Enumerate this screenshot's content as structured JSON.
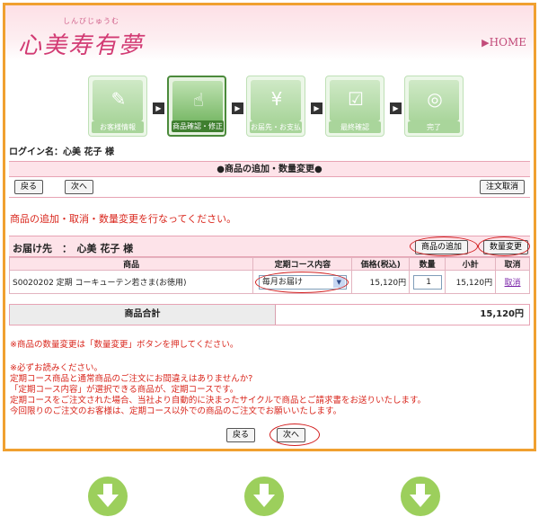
{
  "header": {
    "logo_ruby": "しんびじゅうむ",
    "logo_text": "心美寿有夢",
    "home_link": "HOME",
    "home_arrow": "▶"
  },
  "steps": [
    {
      "label": "お客様情報",
      "icon": "name-card-icon",
      "active": false
    },
    {
      "label": "商品確認・修正",
      "icon": "product-hand-icon",
      "active": true
    },
    {
      "label": "お届先・お支払",
      "icon": "yen-payment-icon",
      "active": false
    },
    {
      "label": "最終確認",
      "icon": "checklist-icon",
      "active": false
    },
    {
      "label": "完了",
      "icon": "globe-icon",
      "active": false
    }
  ],
  "login": "ログイン名：心美 花子 様",
  "section": {
    "title": "●商品の追加・数量変更●",
    "back_label": "戻る",
    "next_label": "次へ",
    "cancel_order_label": "注文取消"
  },
  "instruction": "商品の追加・取消・数量変更を行なってください。",
  "delivery": {
    "label": "お届け先　：　心美 花子 様",
    "add_product_label": "商品の追加",
    "change_qty_label": "数量変更"
  },
  "table": {
    "headers": [
      "商品",
      "定期コース内容",
      "価格(税込)",
      "数量",
      "小計",
      "取消"
    ],
    "rows": [
      {
        "product": "S0020202 定期 コーキューテン若さま(お徳用)",
        "course": "毎月お届け",
        "price": "15,120円",
        "quantity": "1",
        "subtotal": "15,120円",
        "cancel": "取消"
      }
    ]
  },
  "total": {
    "label": "商品合計",
    "value": "15,120円"
  },
  "notes": {
    "qty_hint": "※商品の数量変更は「数量変更」ボタンを押してください。",
    "must_read": "※必ずお読みください。",
    "line1": "定期コース商品と通常商品のご注文にお間違えはありませんか?",
    "line2": "「定期コース内容」が選択できる商品が、定期コースです。",
    "line3": "定期コースをご注文された場合、当社より自動的に決まったサイクルで商品とご請求書をお送りいたします。",
    "line4": "今回限りのご注文のお客様は、定期コース以外での商品のご注文でお願いいたします。"
  },
  "bottom": {
    "back_label": "戻る",
    "next_label": "次へ"
  },
  "colors": {
    "accent_orange": "#f0a030",
    "pink_bar": "#fde3e9",
    "red_text": "#d9261c",
    "step_green": "#4b8a3b",
    "arrow_green": "#9ccf5c"
  }
}
